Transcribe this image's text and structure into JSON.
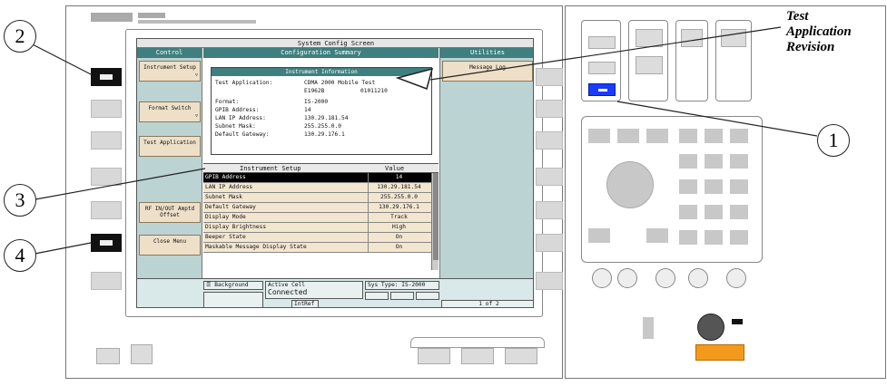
{
  "screen": {
    "title": "System Config Screen",
    "left_header": "Control",
    "center_header": "Configuration Summary",
    "right_header": "Utilities"
  },
  "left_menu": [
    {
      "label": "Instrument Setup"
    },
    {
      "label": "Format Switch"
    },
    {
      "label": "Test Application"
    },
    {
      "label": ""
    },
    {
      "label": "RF IN/OUT Amptd Offset"
    },
    {
      "label": "Close Menu"
    }
  ],
  "right_menu": [
    {
      "label": "Message Log"
    }
  ],
  "instrument_info": {
    "title": "Instrument Information",
    "test_app_label": "Test Application:",
    "test_app_value": "CDMA 2000 Mobile Test",
    "test_app_part": "E1962B",
    "test_app_rev": "01011210",
    "format_label": "Format:",
    "format_value": "IS-2000",
    "gpib_label": "GPIB Address:",
    "gpib_value": "14",
    "lan_label": "LAN IP Address:",
    "lan_value": "130.29.181.54",
    "subnet_label": "Subnet Mask:",
    "subnet_value": "255.255.0.0",
    "gateway_label": "Default Gateway:",
    "gateway_value": "130.29.176.1"
  },
  "instrument_setup": {
    "col_setting": "Instrument Setup",
    "col_value": "Value",
    "rows": [
      {
        "name": "GPIB Address",
        "value": "14"
      },
      {
        "name": "LAN IP Address",
        "value": "130.29.181.54"
      },
      {
        "name": "Subnet Mask",
        "value": "255.255.0.0"
      },
      {
        "name": "Default Gateway",
        "value": "130.29.176.1"
      },
      {
        "name": "Display Mode",
        "value": "Track"
      },
      {
        "name": "Display Brightness",
        "value": "High"
      },
      {
        "name": "Beeper State",
        "value": "On"
      },
      {
        "name": "Maskable Message Display State",
        "value": "On"
      }
    ]
  },
  "status": {
    "background": "Background",
    "active_cell": "Active Cell",
    "connected": "Connected",
    "intref": "IntRef",
    "sys_type": "Sys Type: IS-2000",
    "page": "1 of 2"
  },
  "callouts": {
    "n1": "1",
    "n2": "2",
    "n3": "3",
    "n4": "4",
    "label": "Test Application Revision",
    "label_l1": "Test",
    "label_l2": "Application",
    "label_l3": "Revision"
  },
  "colors": {
    "header_teal": "#3f7f7f",
    "side_panel": "#bcd3d3",
    "softkey_tan": "#eedfc8",
    "highlight_button": "#1a3cff",
    "orange_label": "#f39a1d"
  }
}
